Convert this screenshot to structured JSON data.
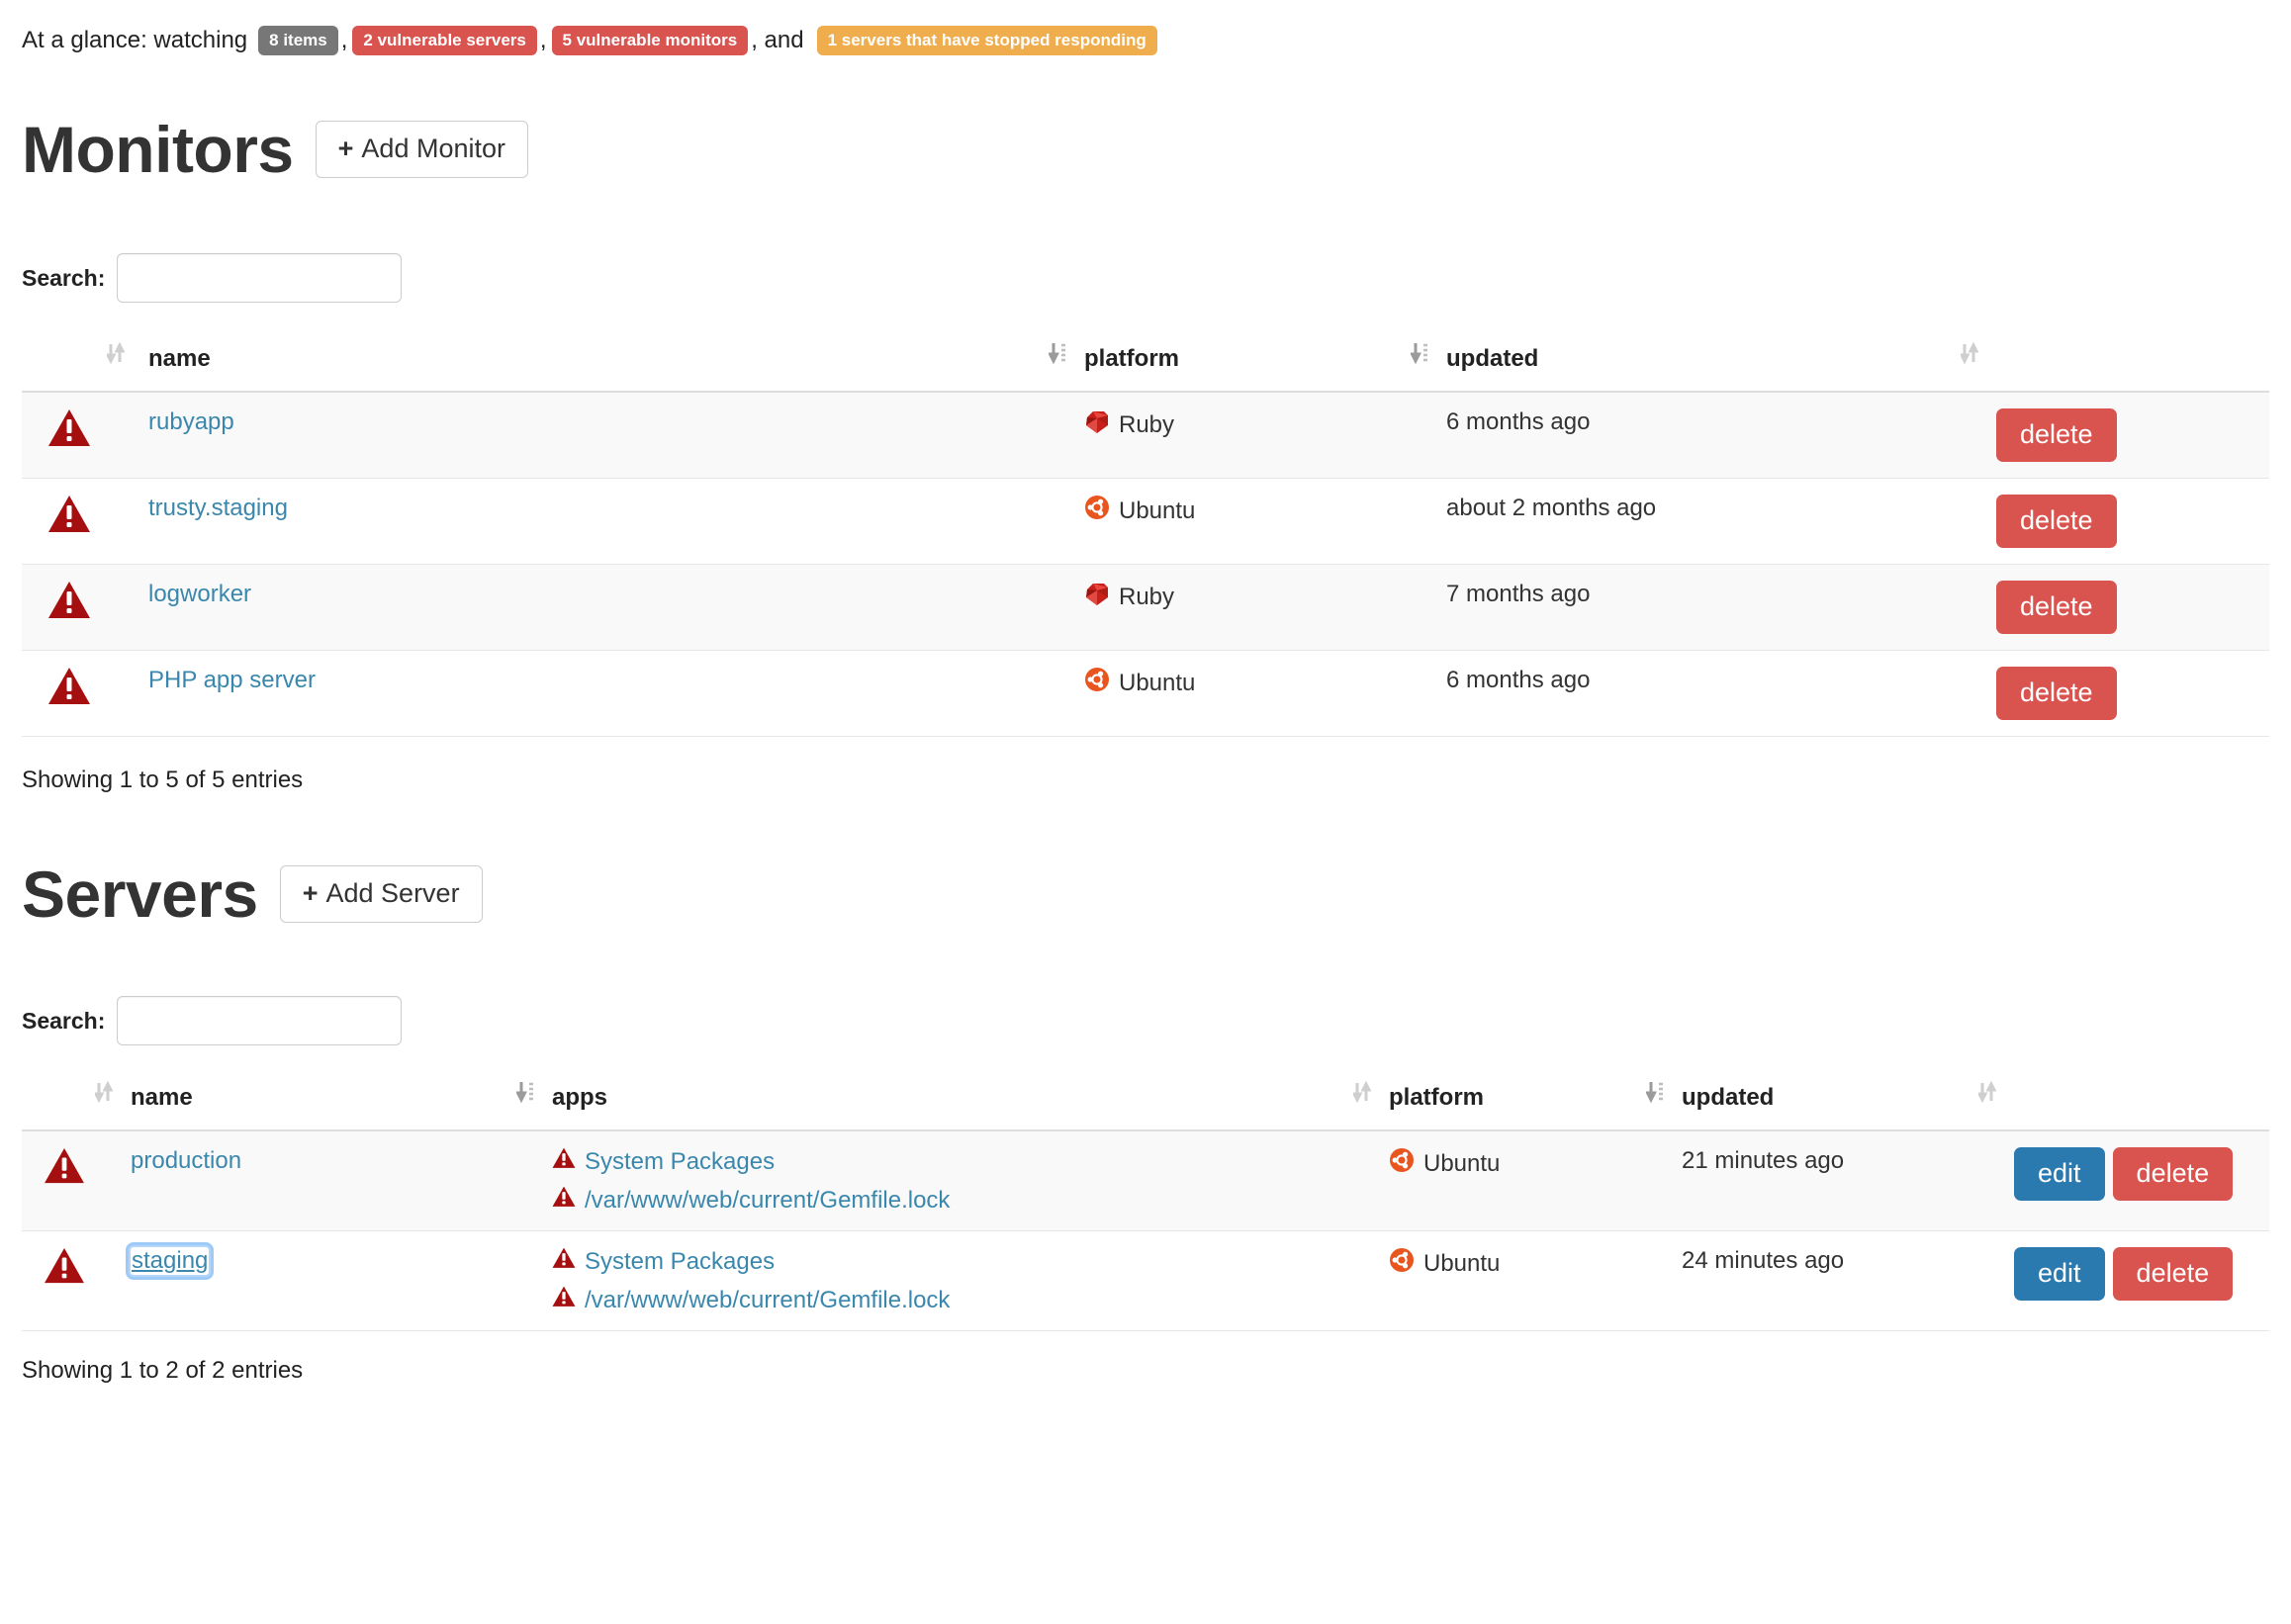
{
  "glance": {
    "prefix": "At a glance: watching",
    "badges": [
      {
        "label": "8 items",
        "style": "default"
      },
      {
        "label": "2 vulnerable servers",
        "style": "danger"
      },
      {
        "label": "5 vulnerable monitors",
        "style": "danger"
      },
      {
        "label": "1 servers that have stopped responding",
        "style": "warning"
      }
    ],
    "sep1": ",",
    "sep2": ",",
    "sep3": ", and"
  },
  "colors": {
    "badge_default": "#777777",
    "badge_danger": "#d9534f",
    "badge_warning": "#efad4e",
    "link": "#3a87ad",
    "warning_triangle": "#a50f0f",
    "btn_danger": "#d9534f",
    "btn_primary": "#2a7ab0",
    "ubuntu_orange": "#e8551f",
    "ruby_red": "#c7201a"
  },
  "monitors": {
    "title": "Monitors",
    "add_label": "Add Monitor",
    "add_plus": "+",
    "search_label": "Search:",
    "search_value": "",
    "search_placeholder": "",
    "columns": [
      "",
      "name",
      "platform",
      "updated",
      ""
    ],
    "rows": [
      {
        "status": "warning",
        "name": "rubyapp",
        "platform": "Ruby",
        "platform_icon": "ruby-icon",
        "updated": "6 months ago",
        "delete_label": "delete"
      },
      {
        "status": "warning",
        "name": "trusty.staging",
        "platform": "Ubuntu",
        "platform_icon": "ubuntu-icon",
        "updated": "about 2 months ago",
        "delete_label": "delete"
      },
      {
        "status": "warning",
        "name": "logworker",
        "platform": "Ruby",
        "platform_icon": "ruby-icon",
        "updated": "7 months ago",
        "delete_label": "delete"
      },
      {
        "status": "warning",
        "name": "PHP app server",
        "platform": "Ubuntu",
        "platform_icon": "ubuntu-icon",
        "updated": "6 months ago",
        "delete_label": "delete"
      }
    ],
    "entries_text": "Showing 1 to 5 of 5 entries"
  },
  "servers": {
    "title": "Servers",
    "add_label": "Add Server",
    "add_plus": "+",
    "search_label": "Search:",
    "search_value": "",
    "search_placeholder": "",
    "columns": [
      "",
      "name",
      "apps",
      "platform",
      "updated",
      ""
    ],
    "rows": [
      {
        "status": "warning",
        "name": "production",
        "name_focused": false,
        "apps": [
          "System Packages",
          "/var/www/web/current/Gemfile.lock"
        ],
        "platform": "Ubuntu",
        "platform_icon": "ubuntu-icon",
        "updated": "21 minutes ago",
        "edit_label": "edit",
        "delete_label": "delete"
      },
      {
        "status": "warning",
        "name": "staging",
        "name_focused": true,
        "apps": [
          "System Packages",
          "/var/www/web/current/Gemfile.lock"
        ],
        "platform": "Ubuntu",
        "platform_icon": "ubuntu-icon",
        "updated": "24 minutes ago",
        "edit_label": "edit",
        "delete_label": "delete"
      }
    ],
    "entries_text": "Showing 1 to 2 of 2 entries"
  }
}
